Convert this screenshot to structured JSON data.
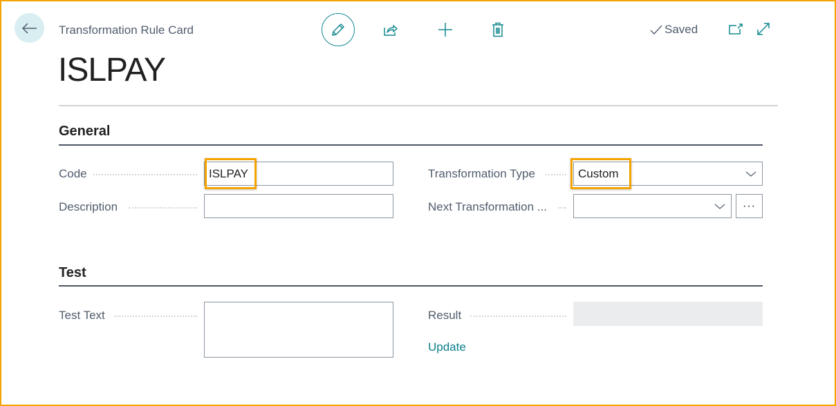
{
  "header": {
    "caption": "Transformation Rule Card",
    "title": "ISLPAY",
    "status": "Saved",
    "icons": {
      "back": "arrow-left-icon",
      "edit": "pencil-icon",
      "share": "share-icon",
      "new": "plus-icon",
      "delete": "trash-icon",
      "saved": "checkmark-icon",
      "popout": "open-in-new-window-icon",
      "expand": "expand-icon"
    }
  },
  "colors": {
    "accent": "#11888f",
    "highlight": "#f4a300",
    "link": "#0b7f8c"
  },
  "sections": {
    "general": {
      "title": "General",
      "code": {
        "label": "Code",
        "value": "ISLPAY"
      },
      "description": {
        "label": "Description",
        "value": ""
      },
      "transformation_type": {
        "label": "Transformation Type",
        "value": "Custom"
      },
      "next_transformation": {
        "label": "Next Transformation ...",
        "value": "",
        "more_label": "···"
      }
    },
    "test": {
      "title": "Test",
      "test_text": {
        "label": "Test Text",
        "value": ""
      },
      "result": {
        "label": "Result",
        "value": ""
      },
      "update_label": "Update"
    }
  }
}
